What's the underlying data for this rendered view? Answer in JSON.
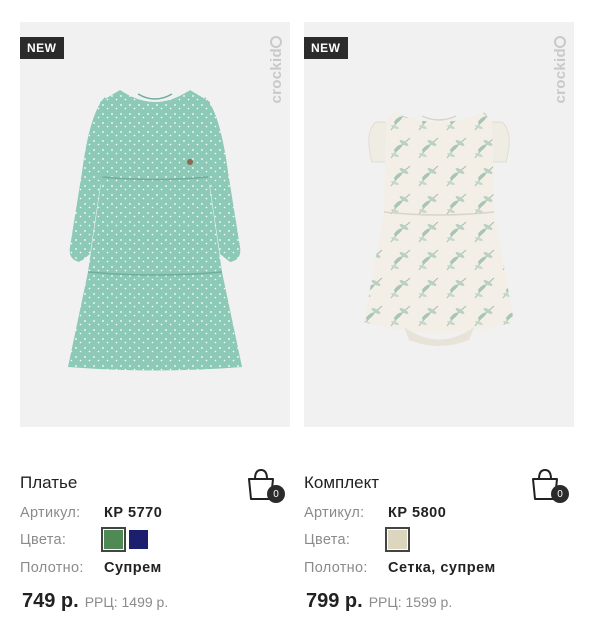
{
  "products": [
    {
      "badge": "NEW",
      "watermark": "crockid",
      "name": "Платье",
      "article_label": "Артикул:",
      "article": "КР 5770",
      "colors_label": "Цвета:",
      "colors": [
        "#4f8a55",
        "#1c1f6e"
      ],
      "fabric_label": "Полотно:",
      "fabric": "Супрем",
      "price": "749 р.",
      "rrp": "РРЦ: 1499 р.",
      "cart_count": "0"
    },
    {
      "badge": "NEW",
      "watermark": "crockid",
      "name": "Комплект",
      "article_label": "Артикул:",
      "article": "КР 5800",
      "colors_label": "Цвета:",
      "colors": [
        "#ddd6bf"
      ],
      "fabric_label": "Полотно:",
      "fabric": "Сетка, супрем",
      "price": "799 р.",
      "rrp": "РРЦ: 1599 р.",
      "cart_count": "0"
    }
  ]
}
